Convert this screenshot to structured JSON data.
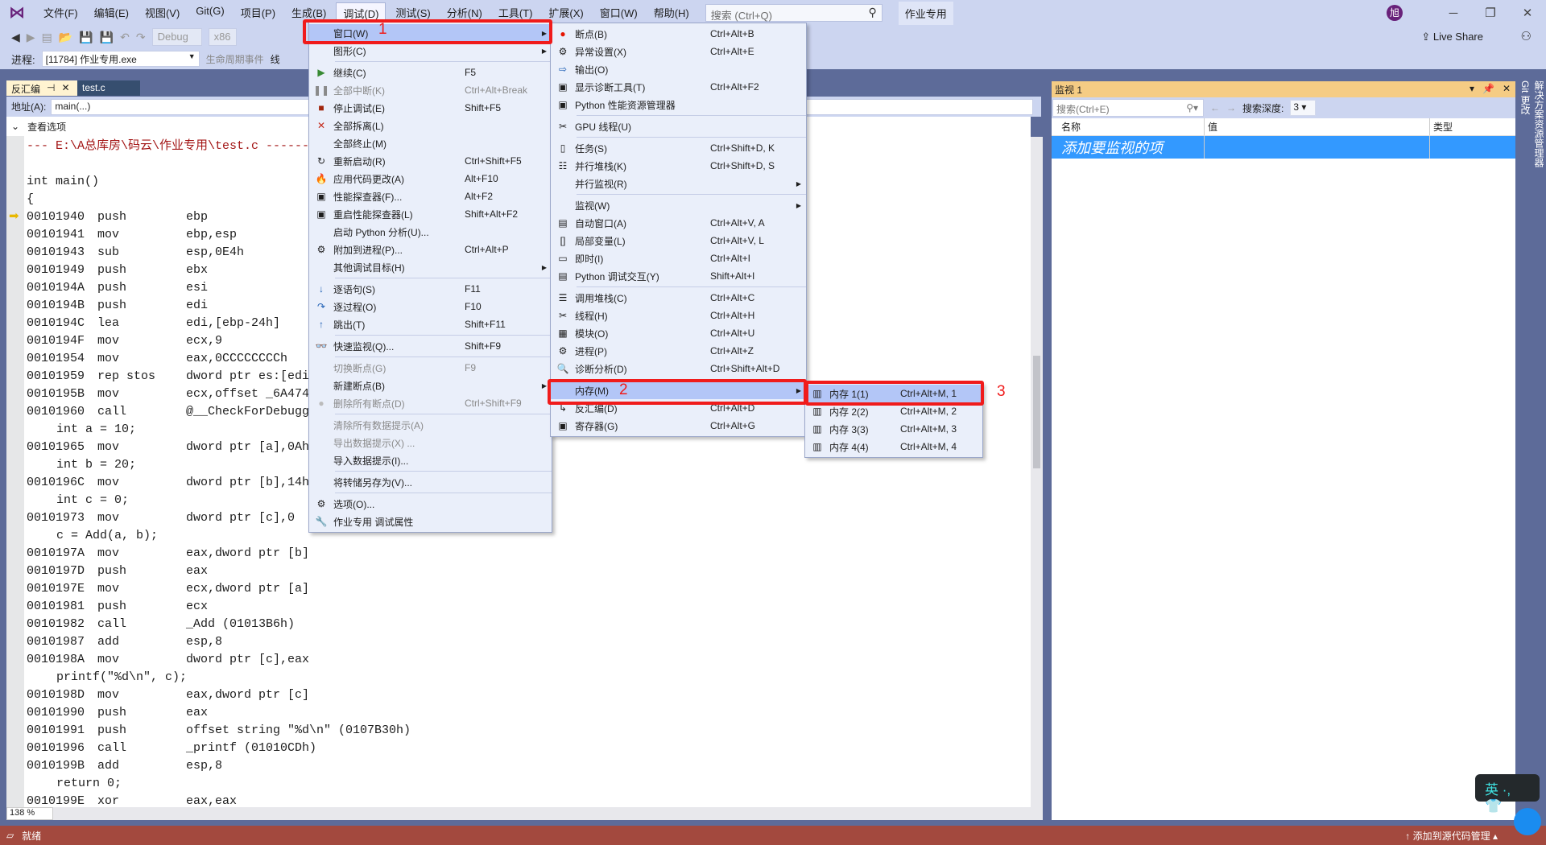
{
  "menubar": {
    "items": [
      "文件(F)",
      "编辑(E)",
      "视图(V)",
      "Git(G)",
      "项目(P)",
      "生成(B)",
      "调试(D)",
      "测试(S)",
      "分析(N)",
      "工具(T)",
      "扩展(X)",
      "窗口(W)",
      "帮助(H)"
    ],
    "active_index": 6,
    "search_placeholder": "搜索 (Ctrl+Q)",
    "solution_name": "作业专用",
    "avatar": "旭"
  },
  "toolbar": {
    "config": "Debug",
    "platform": "x86",
    "live_share": "Live Share",
    "process_label": "进程:",
    "process_value": "[11784] 作业专用.exe",
    "lifecycle": "生命周期事件",
    "thread_label": "线"
  },
  "tabs": [
    {
      "label": "反汇编",
      "active": true
    },
    {
      "label": "test.c",
      "active": false
    }
  ],
  "address": {
    "label": "地址(A):",
    "value": "main(...)"
  },
  "view_options": "查看选项",
  "code": [
    {
      "t": "hdr",
      "text": "--- E:\\A总库房\\码云\\作业专用\\test.c ----------------------------------------------"
    },
    {
      "t": "src",
      "text": ""
    },
    {
      "t": "plain",
      "text": "int main()"
    },
    {
      "t": "plain",
      "text": "{"
    },
    {
      "addr": "00101940",
      "op": "push",
      "args": "ebp"
    },
    {
      "addr": "00101941",
      "op": "mov",
      "args": "ebp,esp"
    },
    {
      "addr": "00101943",
      "op": "sub",
      "args": "esp,0E4h"
    },
    {
      "addr": "00101949",
      "op": "push",
      "args": "ebx"
    },
    {
      "addr": "0010194A",
      "op": "push",
      "args": "esi"
    },
    {
      "addr": "0010194B",
      "op": "push",
      "args": "edi"
    },
    {
      "addr": "0010194C",
      "op": "lea",
      "args": "edi,[ebp-24h]"
    },
    {
      "addr": "0010194F",
      "op": "mov",
      "args": "ecx,9"
    },
    {
      "addr": "00101954",
      "op": "mov",
      "args": "eax,0CCCCCCCCh"
    },
    {
      "addr": "00101959",
      "op": "rep stos",
      "args": "dword ptr es:[edi]"
    },
    {
      "addr": "0010195B",
      "op": "mov",
      "args": "ecx,offset _6A474"
    },
    {
      "addr": "00101960",
      "op": "call",
      "args": "@__CheckForDebuggerJustMyCode"
    },
    {
      "t": "src",
      "text": "int a = 10;"
    },
    {
      "addr": "00101965",
      "op": "mov",
      "args": "dword ptr [a],0Ah"
    },
    {
      "t": "src",
      "text": "int b = 20;"
    },
    {
      "addr": "0010196C",
      "op": "mov",
      "args": "dword ptr [b],14h"
    },
    {
      "t": "src",
      "text": "int c = 0;"
    },
    {
      "addr": "00101973",
      "op": "mov",
      "args": "dword ptr [c],0"
    },
    {
      "t": "src",
      "text": "c = Add(a, b);"
    },
    {
      "addr": "0010197A",
      "op": "mov",
      "args": "eax,dword ptr [b]"
    },
    {
      "addr": "0010197D",
      "op": "push",
      "args": "eax"
    },
    {
      "addr": "0010197E",
      "op": "mov",
      "args": "ecx,dword ptr [a]"
    },
    {
      "addr": "00101981",
      "op": "push",
      "args": "ecx"
    },
    {
      "addr": "00101982",
      "op": "call",
      "args": "_Add (01013B6h)"
    },
    {
      "addr": "00101987",
      "op": "add",
      "args": "esp,8"
    },
    {
      "addr": "0010198A",
      "op": "mov",
      "args": "dword ptr [c],eax"
    },
    {
      "t": "src",
      "text": "printf(\"%d\\n\", c);"
    },
    {
      "addr": "0010198D",
      "op": "mov",
      "args": "eax,dword ptr [c]"
    },
    {
      "addr": "00101990",
      "op": "push",
      "args": "eax"
    },
    {
      "addr": "00101991",
      "op": "push",
      "args": "offset string \"%d\\n\" (0107B30h)"
    },
    {
      "addr": "00101996",
      "op": "call",
      "args": "_printf (01010CDh)"
    },
    {
      "addr": "0010199B",
      "op": "add",
      "args": "esp,8"
    },
    {
      "t": "src",
      "text": "return 0;"
    },
    {
      "addr": "0010199E",
      "op": "xor",
      "args": "eax,eax"
    }
  ],
  "zoom": "138 %",
  "status": {
    "text": "就绪",
    "source_control": "添加到源代码管理"
  },
  "watch": {
    "title": "监视 1",
    "search_placeholder": "搜索(Ctrl+E)",
    "depth_label": "搜索深度:",
    "depth_value": "3",
    "columns": [
      "名称",
      "值",
      "类型"
    ],
    "placeholder_row": "添加要监视的项"
  },
  "side_tabs": [
    "解决方案资源管理器",
    "Git 更改"
  ],
  "debug_menu": [
    {
      "label": "窗口(W)",
      "sub": true,
      "hl": true
    },
    {
      "label": "图形(C)",
      "sub": true
    },
    {
      "sep": true
    },
    {
      "icon": "▶",
      "icon_name": "continue-icon",
      "color": "#388a34",
      "label": "继续(C)",
      "sc": "F5"
    },
    {
      "icon": "❚❚",
      "icon_name": "pause-icon",
      "label": "全部中断(K)",
      "sc": "Ctrl+Alt+Break",
      "dis": true
    },
    {
      "icon": "■",
      "icon_name": "stop-icon",
      "color": "#a1260d",
      "label": "停止调试(E)",
      "sc": "Shift+F5"
    },
    {
      "icon": "✕",
      "icon_name": "detach-icon",
      "color": "#c42b1c",
      "label": "全部拆离(L)"
    },
    {
      "label": "全部终止(M)"
    },
    {
      "icon": "↻",
      "icon_name": "restart-icon",
      "label": "重新启动(R)",
      "sc": "Ctrl+Shift+F5"
    },
    {
      "icon": "🔥",
      "icon_name": "hot-reload-icon",
      "color": "#e51400",
      "label": "应用代码更改(A)",
      "sc": "Alt+F10"
    },
    {
      "icon": "▣",
      "icon_name": "profiler-icon",
      "label": "性能探查器(F)...",
      "sc": "Alt+F2"
    },
    {
      "icon": "▣",
      "icon_name": "profiler-restart-icon",
      "label": "重启性能探查器(L)",
      "sc": "Shift+Alt+F2"
    },
    {
      "label": "启动 Python 分析(U)..."
    },
    {
      "icon": "⚙",
      "icon_name": "attach-icon",
      "label": "附加到进程(P)...",
      "sc": "Ctrl+Alt+P"
    },
    {
      "label": "其他调试目标(H)",
      "sub": true
    },
    {
      "sep": true
    },
    {
      "icon": "↓",
      "icon_name": "step-into-icon",
      "color": "#1e5fb4",
      "label": "逐语句(S)",
      "sc": "F11"
    },
    {
      "icon": "↷",
      "icon_name": "step-over-icon",
      "color": "#1e5fb4",
      "label": "逐过程(O)",
      "sc": "F10"
    },
    {
      "icon": "↑",
      "icon_name": "step-out-icon",
      "color": "#1e5fb4",
      "label": "跳出(T)",
      "sc": "Shift+F11"
    },
    {
      "sep": true
    },
    {
      "icon": "👓",
      "icon_name": "quickwatch-icon",
      "label": "快速监视(Q)...",
      "sc": "Shift+F9"
    },
    {
      "sep": true
    },
    {
      "label": "切换断点(G)",
      "sc": "F9",
      "dis": true
    },
    {
      "label": "新建断点(B)",
      "sub": true
    },
    {
      "icon": "●",
      "icon_name": "delete-breakpoints-icon",
      "color": "#bbb",
      "label": "删除所有断点(D)",
      "sc": "Ctrl+Shift+F9",
      "dis": true
    },
    {
      "sep": true
    },
    {
      "label": "清除所有数据提示(A)",
      "dis": true
    },
    {
      "label": "导出数据提示(X) ...",
      "dis": true
    },
    {
      "label": "导入数据提示(I)..."
    },
    {
      "sep": true
    },
    {
      "label": "将转储另存为(V)..."
    },
    {
      "sep": true
    },
    {
      "icon": "⚙",
      "icon_name": "options-gear-icon",
      "label": "选项(O)..."
    },
    {
      "icon": "🔧",
      "icon_name": "wrench-icon",
      "label": "作业专用 调试属性"
    }
  ],
  "window_menu": [
    {
      "icon": "●",
      "icon_name": "breakpoint-icon",
      "color": "#e51400",
      "label": "断点(B)",
      "sc": "Ctrl+Alt+B"
    },
    {
      "icon": "⚙",
      "icon_name": "exception-settings-icon",
      "label": "异常设置(X)",
      "sc": "Ctrl+Alt+E"
    },
    {
      "icon": "⇨",
      "icon_name": "output-icon",
      "color": "#1e5fb4",
      "label": "输出(O)"
    },
    {
      "icon": "▣",
      "icon_name": "diagnostic-tools-icon",
      "label": "显示诊断工具(T)",
      "sc": "Ctrl+Alt+F2"
    },
    {
      "icon": "▣",
      "icon_name": "python-profiler-icon",
      "label": "Python 性能资源管理器"
    },
    {
      "sep": true
    },
    {
      "icon": "✂",
      "icon_name": "gpu-threads-icon",
      "label": "GPU 线程(U)"
    },
    {
      "sep": true
    },
    {
      "icon": "▯",
      "icon_name": "tasks-icon",
      "label": "任务(S)",
      "sc": "Ctrl+Shift+D, K"
    },
    {
      "icon": "☷",
      "icon_name": "parallel-stacks-icon",
      "label": "并行堆栈(K)",
      "sc": "Ctrl+Shift+D, S"
    },
    {
      "label": "并行监视(R)",
      "sub": true
    },
    {
      "sep": true
    },
    {
      "label": "监视(W)",
      "sub": true
    },
    {
      "icon": "▤",
      "icon_name": "autos-icon",
      "label": "自动窗口(A)",
      "sc": "Ctrl+Alt+V, A"
    },
    {
      "icon": "[]",
      "icon_name": "locals-icon",
      "label": "局部变量(L)",
      "sc": "Ctrl+Alt+V, L"
    },
    {
      "icon": "▭",
      "icon_name": "immediate-icon",
      "label": "即时(I)",
      "sc": "Ctrl+Alt+I"
    },
    {
      "icon": "▤",
      "icon_name": "python-repl-icon",
      "label": "Python 调试交互(Y)",
      "sc": "Shift+Alt+I"
    },
    {
      "sep": true
    },
    {
      "icon": "☰",
      "icon_name": "call-stack-icon",
      "label": "调用堆栈(C)",
      "sc": "Ctrl+Alt+C"
    },
    {
      "icon": "✂",
      "icon_name": "threads-icon",
      "label": "线程(H)",
      "sc": "Ctrl+Alt+H"
    },
    {
      "icon": "▦",
      "icon_name": "modules-icon",
      "label": "模块(O)",
      "sc": "Ctrl+Alt+U"
    },
    {
      "icon": "⚙",
      "icon_name": "processes-icon",
      "label": "进程(P)",
      "sc": "Ctrl+Alt+Z"
    },
    {
      "icon": "🔍",
      "icon_name": "diagnostics-icon",
      "label": "诊断分析(D)",
      "sc": "Ctrl+Shift+Alt+D"
    },
    {
      "sep": true
    },
    {
      "label": "内存(M)",
      "sub": true,
      "hl": true
    },
    {
      "icon": "↳",
      "icon_name": "disassembly-icon",
      "label": "反汇编(D)",
      "sc": "Ctrl+Alt+D"
    },
    {
      "icon": "▣",
      "icon_name": "registers-icon",
      "label": "寄存器(G)",
      "sc": "Ctrl+Alt+G"
    }
  ],
  "memory_menu": [
    {
      "icon": "▥",
      "icon_name": "memory-chip-icon",
      "label": "内存 1(1)",
      "sc": "Ctrl+Alt+M, 1",
      "hl": true
    },
    {
      "icon": "▥",
      "icon_name": "memory-chip-icon",
      "label": "内存 2(2)",
      "sc": "Ctrl+Alt+M, 2"
    },
    {
      "icon": "▥",
      "icon_name": "memory-chip-icon",
      "label": "内存 3(3)",
      "sc": "Ctrl+Alt+M, 3"
    },
    {
      "icon": "▥",
      "icon_name": "memory-chip-icon",
      "label": "内存 4(4)",
      "sc": "Ctrl+Alt+M, 4"
    }
  ],
  "annotations": [
    "1",
    "2",
    "3"
  ],
  "ime": "英 ·, 👕",
  "colors": {
    "accent": "#68217a",
    "highlight_box": "#f01b1b",
    "status_bar": "#a3493e",
    "watch_header": "#f5cc84",
    "selection": "#3399ff"
  }
}
